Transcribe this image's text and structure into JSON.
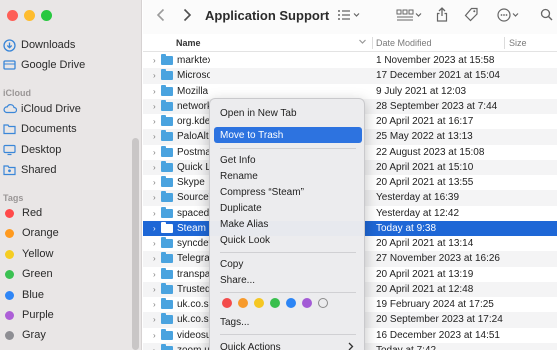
{
  "window": {
    "title": "Application Support"
  },
  "sidebar": {
    "favorites": [
      {
        "label": "Downloads",
        "icon": "downloads-icon"
      },
      {
        "label": "Google Drive",
        "icon": "google-drive-icon"
      }
    ],
    "icloud_heading": "iCloud",
    "icloud": [
      {
        "label": "iCloud Drive",
        "icon": "icloud-drive-icon"
      },
      {
        "label": "Documents",
        "icon": "documents-icon"
      },
      {
        "label": "Desktop",
        "icon": "desktop-icon"
      },
      {
        "label": "Shared",
        "icon": "shared-folder-icon"
      }
    ],
    "tags_heading": "Tags",
    "tags": [
      {
        "label": "Red",
        "color": "#ff4a4a"
      },
      {
        "label": "Orange",
        "color": "#ff9a1f"
      },
      {
        "label": "Yellow",
        "color": "#f5cd22"
      },
      {
        "label": "Green",
        "color": "#3bc152"
      },
      {
        "label": "Blue",
        "color": "#2f86f6"
      },
      {
        "label": "Purple",
        "color": "#ad5fd7"
      },
      {
        "label": "Gray",
        "color": "#8e8e93"
      }
    ]
  },
  "columns": {
    "name": "Name",
    "date": "Date Modified",
    "size": "Size"
  },
  "files": [
    {
      "name": "marktext",
      "date": "1 November 2023 at 15:58"
    },
    {
      "name": "Microsoft",
      "date": "17 December 2021 at 15:04"
    },
    {
      "name": "Mozilla",
      "date": "9 July 2021 at 12:03"
    },
    {
      "name": "network",
      "date": "28 September 2023 at 7:44"
    },
    {
      "name": "org.kde.",
      "date": "20 April 2021 at 16:17"
    },
    {
      "name": "PaloAlto",
      "date": "25 May 2022 at 13:13"
    },
    {
      "name": "Postman",
      "date": "22 August 2023 at 15:08"
    },
    {
      "name": "Quick Lo",
      "date": "20 April 2021 at 15:10"
    },
    {
      "name": "Skype",
      "date": "20 April 2021 at 13:55"
    },
    {
      "name": "SourceT",
      "date": "Yesterday at 16:39"
    },
    {
      "name": "spacedr",
      "date": "Yesterday at 12:42"
    },
    {
      "name": "Steam",
      "date": "Today at 9:38"
    },
    {
      "name": "syncdef",
      "date": "20 April 2021 at 13:14"
    },
    {
      "name": "Telegram",
      "date": "27 November 2023 at 16:26"
    },
    {
      "name": "transpar",
      "date": "20 April 2021 at 13:19"
    },
    {
      "name": "Trusted",
      "date": "20 April 2021 at 12:48"
    },
    {
      "name": "uk.co.sc",
      "date": "19 February 2024 at 17:25"
    },
    {
      "name": "uk.co.sc",
      "date": "20 September 2023 at 17:24"
    },
    {
      "name": "videosu",
      "date": "16 December 2023 at 14:51"
    },
    {
      "name": "zoom.us",
      "date": "Today at 7:42"
    }
  ],
  "context_menu": {
    "open_new_tab": "Open in New Tab",
    "move_to_trash": "Move to Trash",
    "get_info": "Get Info",
    "rename": "Rename",
    "compress": "Compress “Steam”",
    "duplicate": "Duplicate",
    "make_alias": "Make Alias",
    "quick_look": "Quick Look",
    "copy": "Copy",
    "share": "Share...",
    "tag_colors": [
      "#f34b4b",
      "#f79a2c",
      "#f5c722",
      "#39bf4d",
      "#2c85f5",
      "#a35bd6"
    ],
    "tags": "Tags...",
    "quick_actions": "Quick Actions"
  }
}
